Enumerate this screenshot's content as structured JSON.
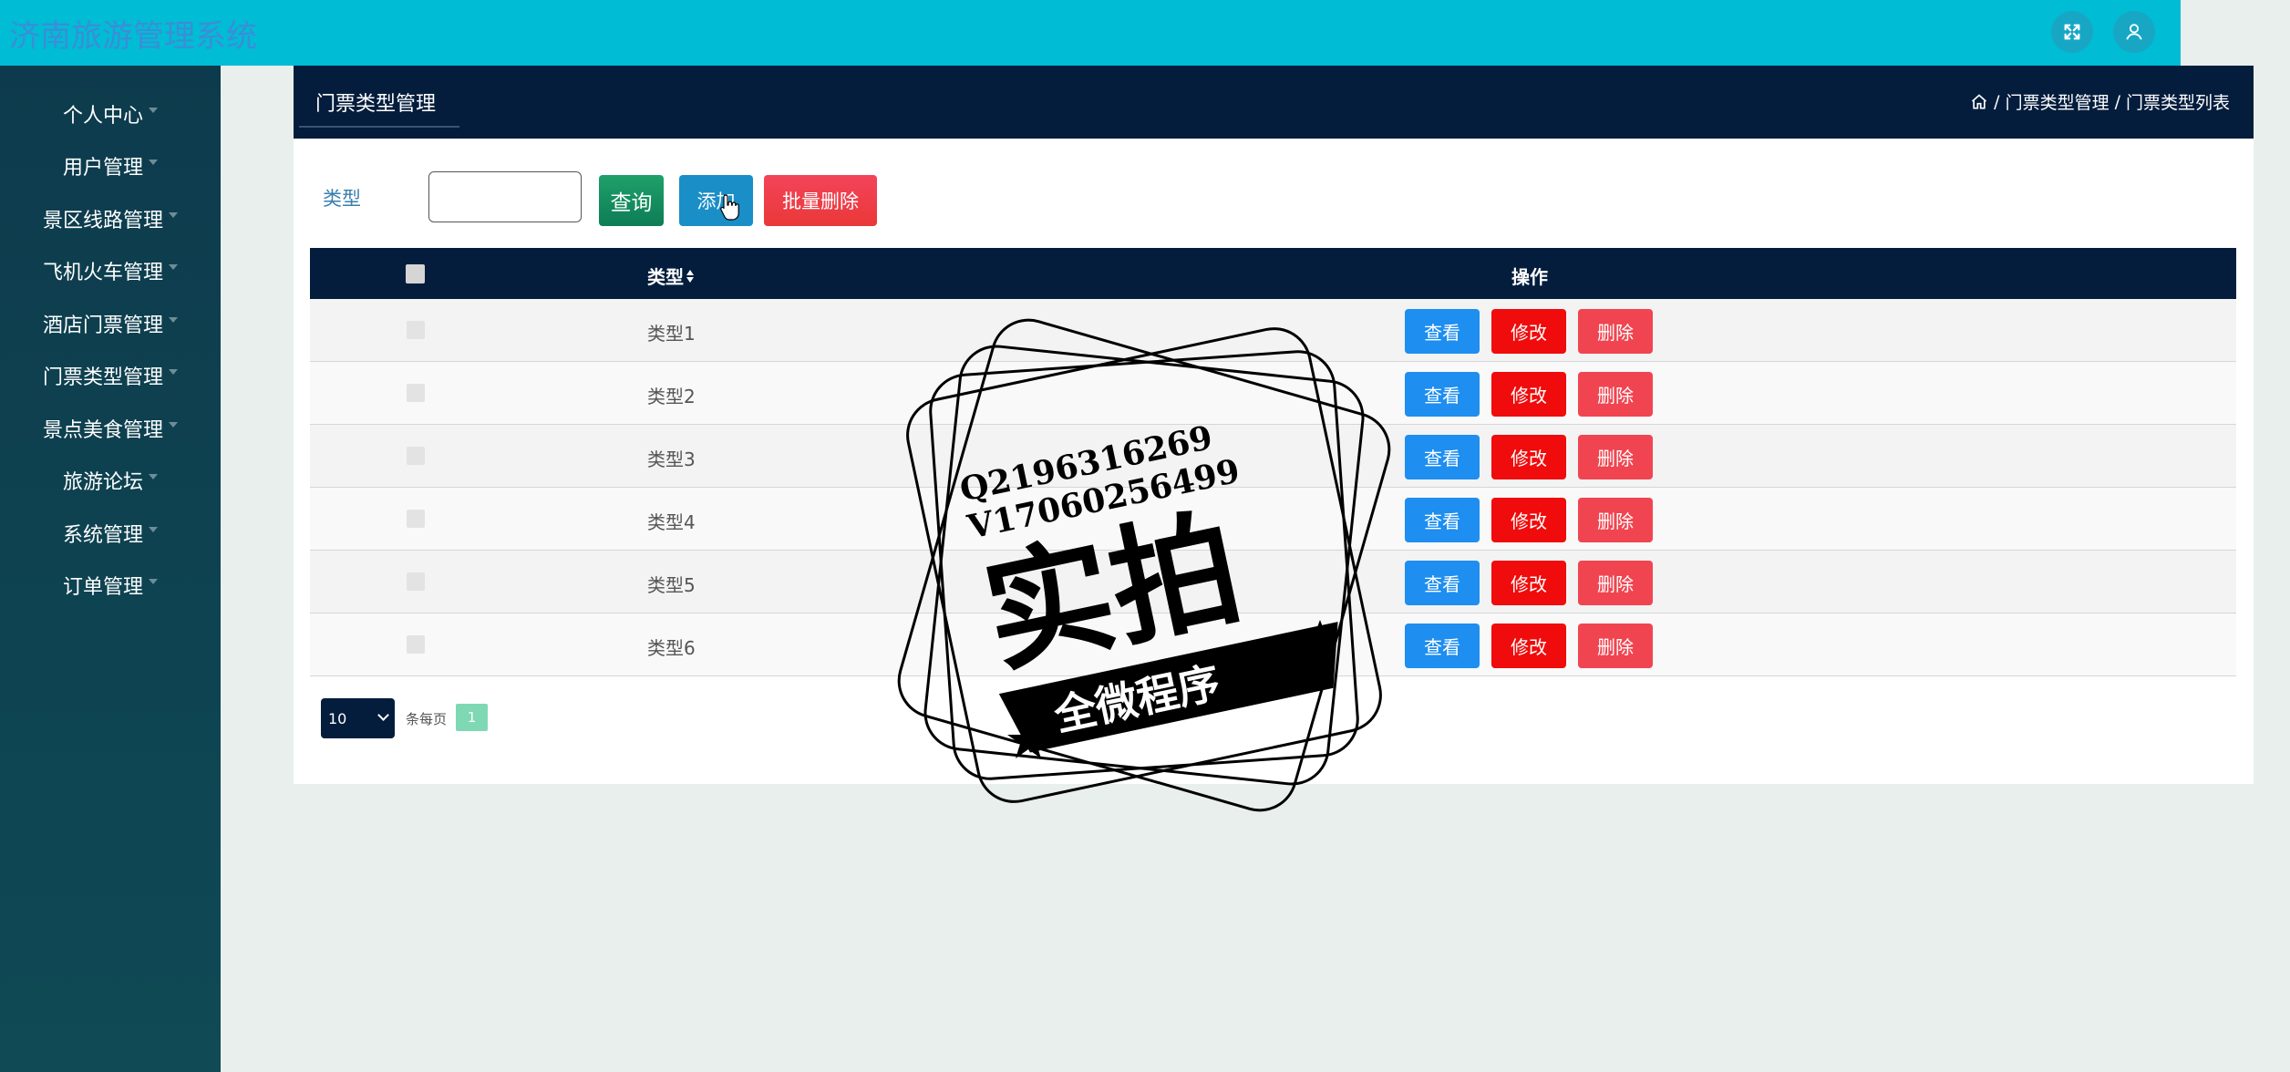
{
  "app": {
    "title": "济南旅游管理系统"
  },
  "header": {
    "icons": [
      "fullscreen-icon",
      "user-icon"
    ]
  },
  "sidebar": {
    "items": [
      {
        "label": "个人中心"
      },
      {
        "label": "用户管理"
      },
      {
        "label": "景区线路管理"
      },
      {
        "label": "飞机火车管理"
      },
      {
        "label": "酒店门票管理"
      },
      {
        "label": "门票类型管理"
      },
      {
        "label": "景点美食管理"
      },
      {
        "label": "旅游论坛"
      },
      {
        "label": "系统管理"
      },
      {
        "label": "订单管理"
      }
    ]
  },
  "panel": {
    "tab_label": "门票类型管理",
    "breadcrumb": {
      "sep": "/",
      "level1": "门票类型管理",
      "level2": "门票类型列表"
    }
  },
  "search": {
    "label": "类型",
    "input_value": "",
    "query_label": "查询",
    "add_label": "添加",
    "batch_delete_label": "批量删除"
  },
  "table": {
    "headers": {
      "type": "类型",
      "ops": "操作"
    },
    "rows": [
      {
        "type": "类型1"
      },
      {
        "type": "类型2"
      },
      {
        "type": "类型3"
      },
      {
        "type": "类型4"
      },
      {
        "type": "类型5"
      },
      {
        "type": "类型6"
      }
    ],
    "actions": {
      "view": "查看",
      "edit": "修改",
      "delete": "删除"
    }
  },
  "pagination": {
    "page_size": "10",
    "per_page_label": "条每页",
    "current_page": "1"
  },
  "watermark": {
    "line1": "Q2196316269",
    "line2": "V17060256499",
    "main": "实拍",
    "banner": "全微程序"
  },
  "colors": {
    "header": "#00bcd4",
    "sidebar": "#0d3b4d",
    "navy": "#041d3d",
    "view": "#1e8ef0",
    "edit": "#f00c0c",
    "delete": "#f04550"
  }
}
